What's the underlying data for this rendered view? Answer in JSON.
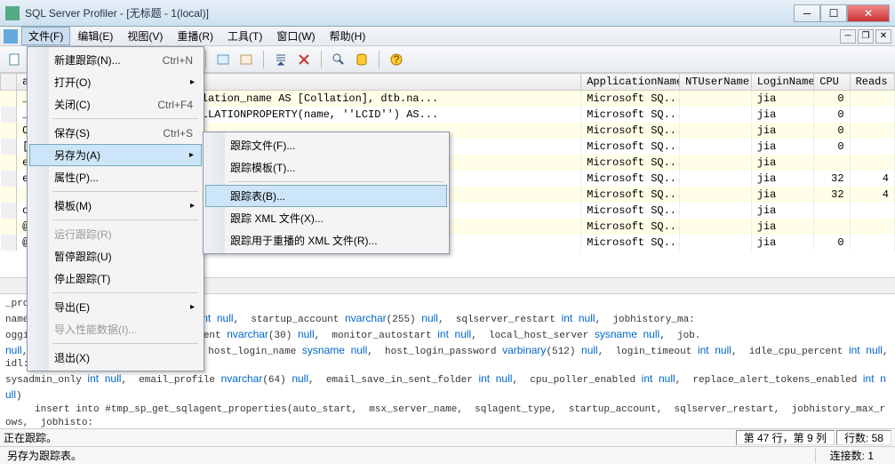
{
  "titlebar": {
    "text": "SQL Server Profiler - [无标题 - 1(local)]"
  },
  "menubar": {
    "items": [
      {
        "label": "文件(F)",
        "open": true
      },
      {
        "label": "编辑(E)"
      },
      {
        "label": "视图(V)"
      },
      {
        "label": "重播(R)"
      },
      {
        "label": "工具(T)"
      },
      {
        "label": "窗口(W)"
      },
      {
        "label": "帮助(H)"
      }
    ]
  },
  "file_menu": {
    "new_trace": "新建跟踪(N)...",
    "new_trace_sc": "Ctrl+N",
    "open": "打开(O)",
    "close": "关闭(C)",
    "close_sc": "Ctrl+F4",
    "save": "保存(S)",
    "save_sc": "Ctrl+S",
    "save_as": "另存为(A)",
    "properties": "属性(P)...",
    "templates": "模板(M)",
    "run_trace": "运行跟踪(R)",
    "pause_trace": "暂停跟踪(U)",
    "stop_trace": "停止跟踪(T)",
    "export": "导出(E)",
    "import_perf": "导入性能数据(I)...",
    "exit": "退出(X)"
  },
  "saveas_menu": {
    "trace_file": "跟踪文件(F)...",
    "trace_template": "跟踪模板(T)...",
    "trace_table": "跟踪表(B)...",
    "trace_xml": "跟踪 XML 文件(X)...",
    "trace_replay_xml": "跟踪用于重播的 XML 文件(R)..."
  },
  "grid": {
    "columns": [
      "",
      "a",
      "ApplicationName",
      "NTUserName",
      "LoginName",
      "CPU",
      "Reads"
    ],
    "rows": [
      {
        "txt": "_executesql N'SELECT dtb.collation_name AS [Collation], dtb.na...",
        "app": "Microsoft SQ...",
        "nt": "",
        "login": "jia",
        "cpu": "0",
        "reads": "",
        "alt": true
      },
      {
        "txt": "_executesql N'SELECT CAST(COLLATIONPROPERTY(name, ''LCID'') AS...",
        "app": "Microsoft SQ...",
        "nt": "",
        "login": "jia",
        "cpu": "0",
        "reads": ""
      },
      {
        "txt": "OM master.sys.databa..",
        "app": "Microsoft SQ...",
        "nt": "",
        "login": "jia",
        "cpu": "0",
        "reads": "",
        "alt": true
      },
      {
        "txt": "[Collation], dtb.na...",
        "app": "Microsoft SQ...",
        "nt": "",
        "login": "jia",
        "cpu": "0",
        "reads": ""
      },
      {
        "txt": "erties        (auto..",
        "app": "Microsoft SQ...",
        "nt": "",
        "login": "jia",
        "cpu": "",
        "reads": "",
        "alt": true
      },
      {
        "txt": "erties        (auto..",
        "app": "Microsoft SQ...",
        "nt": "",
        "login": "jia",
        "cpu": "32",
        "reads": "4"
      },
      {
        "txt": "",
        "app": "Microsoft SQ...",
        "nt": "",
        "login": "jia",
        "cpu": "32",
        "reads": "4",
        "alt": true
      },
      {
        "txt": "on  set arithabort of..",
        "app": "Microsoft SQ...",
        "nt": "",
        "login": "jia",
        "cpu": "",
        "reads": ""
      },
      {
        "txt": "@edition sysname;  SET @edition = cast(SERVERPROPERTY(N'EDITIO.",
        "app": "Microsoft SQ...",
        "nt": "",
        "login": "jia",
        "cpu": "",
        "reads": "",
        "alt": true
      },
      {
        "txt": "@edition sysname;  SET @edition = cast(SERVERPROPERTY(N'EDITIO..",
        "app": "Microsoft SQ...",
        "nt": "",
        "login": "jia",
        "cpu": "0",
        "reads": ""
      }
    ]
  },
  "text_pane": "_properties\nname sysname null,  sqlagent_type int null,  startup_account nvarchar(255) null,  sqlserver_restart int null,  jobhistory_ma:\nogging_level int null,  error_recipient nvarchar(30) null,  monitor_autostart int null,  local_host_server sysname null,  job.\nnull,  regular_connections int null,  host_login_name sysname null,  host_login_password varbinary(512) null,  login_timeout int null,  idle_cpu_percent int null,  idl:\nsysadmin_only int null,  email_profile nvarchar(64) null,  email_save_in_sent_folder int null,  cpu_poller_enabled int null,  replace_alert_tokens_enabled int null)\n     insert into #tmp_sp_get_sqlagent_properties(auto_start,  msx_server_name,  sqlagent_type,  startup_account,  sqlserver_restart,  jobhistory_max_rows,  jobhisto:\nerror_recipient,  monitor_autostart,  local_host_server,  job_shutdown_timeout,  cmdexec_account,  regular_connections,  host_login_name,  host_login_password,  login_ti\nsysadmin_only,  email_profile,  email_save_in_sent_folder,  cpu_poller_enabled,  replace_alert_tokens_enabled)\n        exec msdb.dbo.sp_get_sqlagent_properties",
  "status1": {
    "tracing": "正在跟踪。",
    "position": "第 47 行，第 9 列",
    "rows": "行数: 58"
  },
  "status2": {
    "save_as_table": "另存为跟踪表。",
    "connections": "连接数: 1"
  }
}
